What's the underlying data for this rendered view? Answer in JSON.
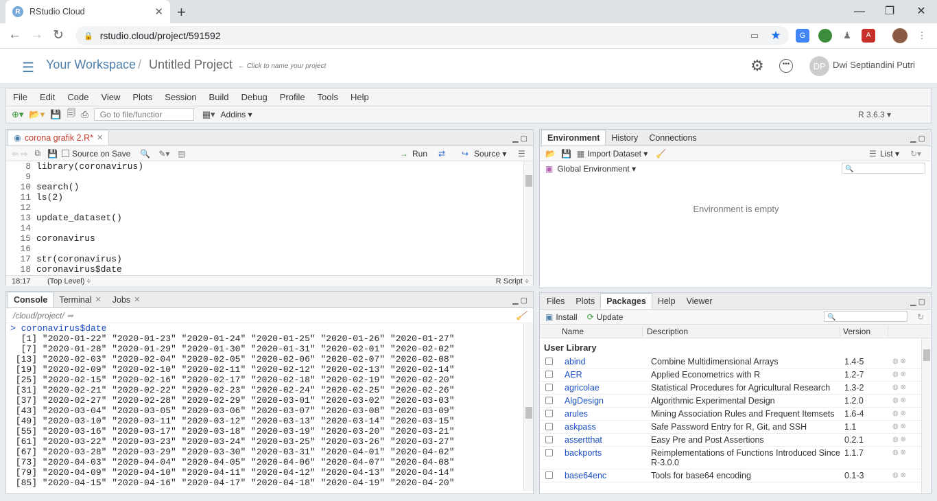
{
  "browser": {
    "tab_title": "RStudio Cloud",
    "favicon_letter": "R",
    "new_tab": "+",
    "close_tab": "✕",
    "url": "rstudio.cloud/project/591592",
    "win_min": "—",
    "win_restore": "❐",
    "win_close": "✕"
  },
  "cloud_header": {
    "workspace": "Your Workspace",
    "separator": "/",
    "project": "Untitled Project",
    "hint": "← Click to name your project",
    "avatar_initials": "DP",
    "user_name": "Dwi Septiandini Putri"
  },
  "menu": [
    "File",
    "Edit",
    "Code",
    "View",
    "Plots",
    "Session",
    "Build",
    "Debug",
    "Profile",
    "Tools",
    "Help"
  ],
  "toolbar": {
    "goto_placeholder": "Go to file/functior",
    "addins": "Addins ▾",
    "r_version": "R 3.6.3 ▾"
  },
  "source": {
    "tab": "corona grafik 2.R*",
    "source_on_save": "Source on Save",
    "run": "Run",
    "source": "Source ▾",
    "lines": [
      {
        "n": "8",
        "t": "library(coronavirus)"
      },
      {
        "n": "9",
        "t": ""
      },
      {
        "n": "10",
        "t": "search()"
      },
      {
        "n": "11",
        "t": "ls(2)"
      },
      {
        "n": "12",
        "t": ""
      },
      {
        "n": "13",
        "t": "update_dataset()"
      },
      {
        "n": "14",
        "t": ""
      },
      {
        "n": "15",
        "t": "coronavirus"
      },
      {
        "n": "16",
        "t": ""
      },
      {
        "n": "17",
        "t": "str(coronavirus)"
      },
      {
        "n": "18",
        "t": "coronavirus$date"
      }
    ],
    "cursor_pos": "18:17",
    "scope": "(Top Level) ÷",
    "file_type": "R Script ÷"
  },
  "console": {
    "tabs": [
      {
        "label": "Console",
        "closable": false
      },
      {
        "label": "Terminal",
        "closable": true
      },
      {
        "label": "Jobs",
        "closable": true
      }
    ],
    "path": "/cloud/project/",
    "command": "coronavirus$date",
    "prompt": ">",
    "output": [
      "  [1] \"2020-01-22\" \"2020-01-23\" \"2020-01-24\" \"2020-01-25\" \"2020-01-26\" \"2020-01-27\"",
      "  [7] \"2020-01-28\" \"2020-01-29\" \"2020-01-30\" \"2020-01-31\" \"2020-02-01\" \"2020-02-02\"",
      " [13] \"2020-02-03\" \"2020-02-04\" \"2020-02-05\" \"2020-02-06\" \"2020-02-07\" \"2020-02-08\"",
      " [19] \"2020-02-09\" \"2020-02-10\" \"2020-02-11\" \"2020-02-12\" \"2020-02-13\" \"2020-02-14\"",
      " [25] \"2020-02-15\" \"2020-02-16\" \"2020-02-17\" \"2020-02-18\" \"2020-02-19\" \"2020-02-20\"",
      " [31] \"2020-02-21\" \"2020-02-22\" \"2020-02-23\" \"2020-02-24\" \"2020-02-25\" \"2020-02-26\"",
      " [37] \"2020-02-27\" \"2020-02-28\" \"2020-02-29\" \"2020-03-01\" \"2020-03-02\" \"2020-03-03\"",
      " [43] \"2020-03-04\" \"2020-03-05\" \"2020-03-06\" \"2020-03-07\" \"2020-03-08\" \"2020-03-09\"",
      " [49] \"2020-03-10\" \"2020-03-11\" \"2020-03-12\" \"2020-03-13\" \"2020-03-14\" \"2020-03-15\"",
      " [55] \"2020-03-16\" \"2020-03-17\" \"2020-03-18\" \"2020-03-19\" \"2020-03-20\" \"2020-03-21\"",
      " [61] \"2020-03-22\" \"2020-03-23\" \"2020-03-24\" \"2020-03-25\" \"2020-03-26\" \"2020-03-27\"",
      " [67] \"2020-03-28\" \"2020-03-29\" \"2020-03-30\" \"2020-03-31\" \"2020-04-01\" \"2020-04-02\"",
      " [73] \"2020-04-03\" \"2020-04-04\" \"2020-04-05\" \"2020-04-06\" \"2020-04-07\" \"2020-04-08\"",
      " [79] \"2020-04-09\" \"2020-04-10\" \"2020-04-11\" \"2020-04-12\" \"2020-04-13\" \"2020-04-14\"",
      " [85] \"2020-04-15\" \"2020-04-16\" \"2020-04-17\" \"2020-04-18\" \"2020-04-19\" \"2020-04-20\""
    ]
  },
  "environment": {
    "tabs": [
      "Environment",
      "History",
      "Connections"
    ],
    "import_dataset": "Import Dataset ▾",
    "list_view": "List ▾",
    "scope": "Global Environment ▾",
    "empty_msg": "Environment is empty"
  },
  "packages": {
    "tabs": [
      "Files",
      "Plots",
      "Packages",
      "Help",
      "Viewer"
    ],
    "install": "Install",
    "update": "Update",
    "columns": [
      "Name",
      "Description",
      "Version"
    ],
    "section": "User Library",
    "rows": [
      {
        "name": "abind",
        "desc": "Combine Multidimensional Arrays",
        "ver": "1.4-5"
      },
      {
        "name": "AER",
        "desc": "Applied Econometrics with R",
        "ver": "1.2-7"
      },
      {
        "name": "agricolae",
        "desc": "Statistical Procedures for Agricultural Research",
        "ver": "1.3-2"
      },
      {
        "name": "AlgDesign",
        "desc": "Algorithmic Experimental Design",
        "ver": "1.2.0"
      },
      {
        "name": "arules",
        "desc": "Mining Association Rules and Frequent Itemsets",
        "ver": "1.6-4"
      },
      {
        "name": "askpass",
        "desc": "Safe Password Entry for R, Git, and SSH",
        "ver": "1.1"
      },
      {
        "name": "assertthat",
        "desc": "Easy Pre and Post Assertions",
        "ver": "0.2.1"
      },
      {
        "name": "backports",
        "desc": "Reimplementations of Functions Introduced Since R-3.0.0",
        "ver": "1.1.7"
      },
      {
        "name": "base64enc",
        "desc": "Tools for base64 encoding",
        "ver": "0.1-3"
      }
    ]
  }
}
